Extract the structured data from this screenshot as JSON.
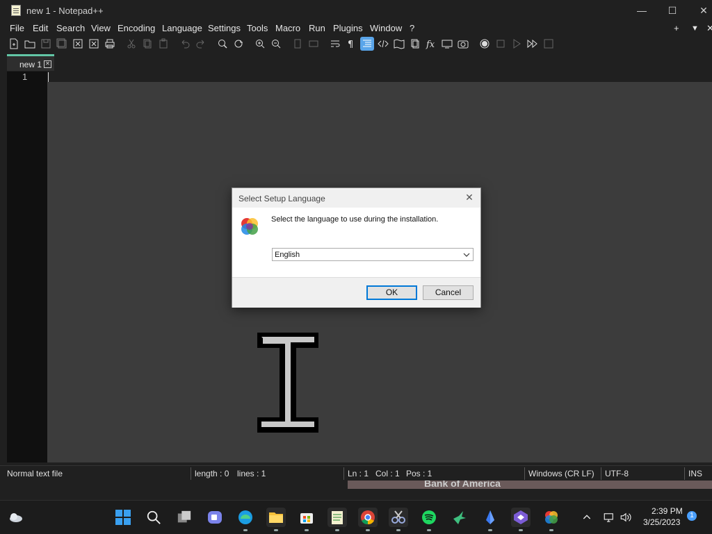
{
  "window": {
    "title": "new 1 - Notepad++",
    "minimize": "—",
    "maximize": "☐",
    "close": "✕"
  },
  "menu": [
    {
      "label": "File"
    },
    {
      "label": "Edit"
    },
    {
      "label": "Search"
    },
    {
      "label": "View"
    },
    {
      "label": "Encoding"
    },
    {
      "label": "Language"
    },
    {
      "label": "Settings"
    },
    {
      "label": "Tools"
    },
    {
      "label": "Macro"
    },
    {
      "label": "Run"
    },
    {
      "label": "Plugins"
    },
    {
      "label": "Window"
    },
    {
      "label": "?"
    }
  ],
  "menu_right": {
    "plus": "+",
    "dropdown": "▼",
    "close": "✕"
  },
  "tab": {
    "label": "new 1",
    "close": "✕"
  },
  "editor": {
    "line_number": "1"
  },
  "status": {
    "file_type": "Normal text file",
    "length": "length : 0",
    "lines": "lines : 1",
    "ln": "Ln : 1",
    "col": "Col : 1",
    "pos": "Pos : 1",
    "eol": "Windows (CR LF)",
    "encoding": "UTF-8",
    "mode": "INS"
  },
  "background_window_text": "Bank of America",
  "dialog": {
    "title": "Select Setup Language",
    "close": "✕",
    "message": "Select the language to use during the installation.",
    "language_selected": "English",
    "ok_label": "OK",
    "cancel_label": "Cancel"
  },
  "taskbar": {
    "time": "2:39 PM",
    "date": "3/25/2023",
    "notification_count": "1",
    "chevron": "^"
  },
  "colors": {
    "accent": "#5aa5ea",
    "tab_accent": "#62c6a6",
    "dialog_default_border": "#0078d7"
  }
}
